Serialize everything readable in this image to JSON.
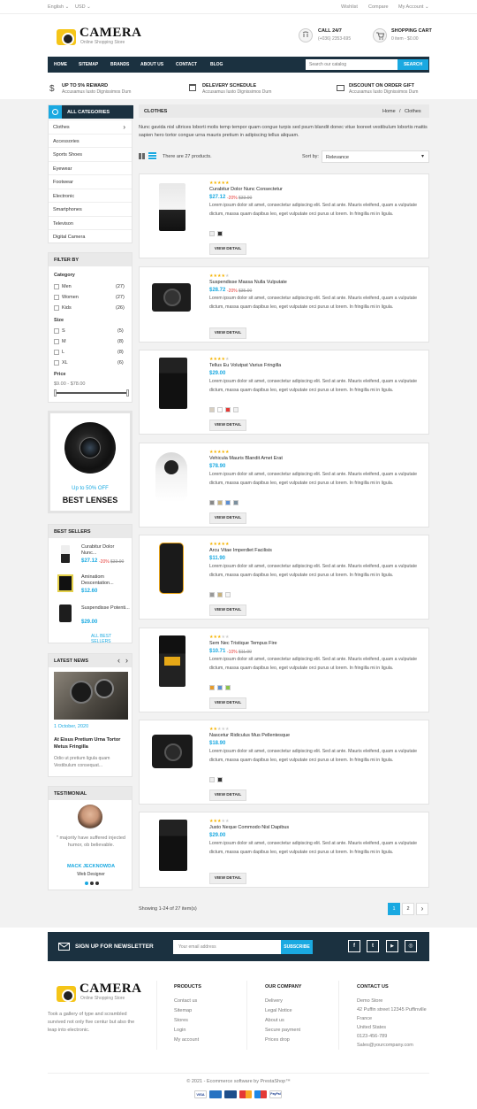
{
  "topbar": {
    "language": "English ⌄",
    "currency": "USD ⌄",
    "wishlist": "Wishlist",
    "compare": "Compare",
    "account": "My Account ⌄"
  },
  "logo": {
    "name": "CAMERA",
    "tagline": "Online Shopping Store"
  },
  "call": {
    "title": "CALL 24/7",
    "phone": "(+036) 2353-695"
  },
  "cart": {
    "title": "SHOPPING CART",
    "summary": "0 item - $0.00"
  },
  "nav": {
    "items": [
      "HOME",
      "SITEMAP",
      "BRANDS",
      "ABOUT US",
      "CONTACT",
      "BLOG"
    ],
    "search_placeholder": "Search our catalog",
    "search_button": "SEARCH"
  },
  "promos": [
    {
      "title": "UP TO 5% REWARD",
      "text": "Accusamus Iusto Dignissimos Dum"
    },
    {
      "title": "DELEVERY SCHEDULE",
      "text": "Accusamus Iusto Dignissimos Dum"
    },
    {
      "title": "DISCOUNT ON ORDER GIFT",
      "text": "Accusamus Iusto Dignissimos Dum"
    }
  ],
  "categories": {
    "title": "ALL CATEGORIES",
    "items": [
      "Clothes",
      "Accessories",
      "Sports Shoes",
      "Eyewear",
      "Footwear",
      "Electronic",
      "Smartphones",
      "Televison",
      "Digital Camera"
    ],
    "arrow": "›"
  },
  "filter": {
    "title": "FILTER BY",
    "category_label": "Category",
    "categories": [
      {
        "name": "Men",
        "count": "(27)"
      },
      {
        "name": "Women",
        "count": "(27)"
      },
      {
        "name": "Kids",
        "count": "(26)"
      }
    ],
    "size_label": "Size",
    "sizes": [
      {
        "name": "S",
        "count": "(5)"
      },
      {
        "name": "M",
        "count": "(8)"
      },
      {
        "name": "L",
        "count": "(8)"
      },
      {
        "name": "XL",
        "count": "(6)"
      }
    ],
    "price_label": "Price",
    "price_range": "$9.00 - $78.00"
  },
  "banner": {
    "offer": "Up to 50% OFF",
    "title": "BEST LENSES"
  },
  "best_sellers": {
    "title": "BEST SELLERS",
    "items": [
      {
        "name": "Curabitur Dolor Nunc...",
        "price": "$27.12",
        "discount": "-20%",
        "old": "$33.90"
      },
      {
        "name": "Aminatiom Descentation...",
        "price": "$12.60",
        "discount": "",
        "old": ""
      },
      {
        "name": "Suspendisse Potenti...",
        "price": "$29.00",
        "discount": "",
        "old": ""
      }
    ],
    "link": "ALL BEST SELLERS"
  },
  "latest_news": {
    "title": "LATEST NEWS",
    "prev": "‹",
    "next": "›",
    "date": "1 October, 2020",
    "headline": "At Eisus Pretium Urna Tortor Metus Fringilla",
    "excerpt": "Odio ut pretium ligula quam Vestibulum consequat..."
  },
  "testimonial": {
    "title": "TESTIMONIAL",
    "quote": "\" majority have suffered injected humor, ob believable.",
    "name": "MACK JECKNOWDA",
    "role": "Web Designer"
  },
  "breadcrumb": {
    "section": "CLOTHES",
    "home": "Home",
    "sep": "/",
    "current": "Clothes"
  },
  "category_desc": "Nunc gavida nisl ultrices loborti molis temp tempor quam congue turpis sed psum blandit donec vitue looreet vestibulum lobortis mattis sapien hero tortor congue urna mauris pretium in adipiscing tellus aliquam.",
  "toolbar": {
    "count": "There are 27 products.",
    "sort_label": "Sort by:",
    "sort_value": "Relevance",
    "sort_arrow": "▾"
  },
  "products": [
    {
      "stars": "★★★★★",
      "name": "Curabitur Dolor Nunc Consectetur",
      "price": "$27.12",
      "discount": "-20%",
      "old": "$33.90",
      "desc": "Lorem ipsum dolor sit amet, consectetur adipiscing elit. Sed at ante. Mauris eleifend, quam a vulputate dictum, massa quam dapibus leo, eget vulputate orci purus ut lorem. In fringilla mi in ligula.",
      "colors": [
        "#eeeeee",
        "#333333"
      ],
      "button": "VIEW DETAIL"
    },
    {
      "stars": "★★★★☆",
      "name": "Suspendisse Massa Nulla Vulputate",
      "price": "$28.72",
      "discount": "-20%",
      "old": "$35.90",
      "desc": "Lorem ipsum dolor sit amet, consectetur adipiscing elit. Sed at ante. Mauris eleifend, quam a vulputate dictum, massa quam dapibus leo, eget vulputate orci purus ut lorem. In fringilla mi in ligula.",
      "colors": [],
      "button": "VIEW DETAIL"
    },
    {
      "stars": "★★★★☆",
      "name": "Tellus Eu Volutpat Varius Fringilla",
      "price": "$29.00",
      "discount": "",
      "old": "",
      "desc": "Lorem ipsum dolor sit amet, consectetur adipiscing elit. Sed at ante. Mauris eleifend, quam a vulputate dictum, massa quam dapibus leo, eget vulputate orci purus ut lorem. In fringilla mi in ligula.",
      "colors": [
        "#d8cfc0",
        "#ffffff",
        "#e53935",
        "#f0f0f0"
      ],
      "button": "VIEW DETAIL"
    },
    {
      "stars": "★★★★★",
      "name": "Vehicula Mauris Blandit Amet Erat",
      "price": "$78.90",
      "discount": "",
      "old": "",
      "desc": "Lorem ipsum dolor sit amet, consectetur adipiscing elit. Sed at ante. Mauris eleifend, quam a vulputate dictum, massa quam dapibus leo, eget vulputate orci purus ut lorem. In fringilla mi in ligula.",
      "colors": [
        "#888888",
        "#c7b07a",
        "#5b8fd4",
        "#7b8f9e"
      ],
      "button": "VIEW DETAIL"
    },
    {
      "stars": "★★★★★",
      "name": "Arcu Vitae Imperdiet Facilisis",
      "price": "$11.90",
      "discount": "",
      "old": "",
      "desc": "Lorem ipsum dolor sit amet, consectetur adipiscing elit. Sed at ante. Mauris eleifend, quam a vulputate dictum, massa quam dapibus leo, eget vulputate orci purus ut lorem. In fringilla mi in ligula.",
      "colors": [
        "#999999",
        "#c7b07a",
        "#f4f4f4"
      ],
      "button": "VIEW DETAIL"
    },
    {
      "stars": "★★★☆☆",
      "name": "Sem Nec Tristique Tempus Fire",
      "price": "$10.71",
      "discount": "-10%",
      "old": "$11.90",
      "desc": "Lorem ipsum dolor sit amet, consectetur adipiscing elit. Sed at ante. Mauris eleifend, quam a vulputate dictum, massa quam dapibus leo, eget vulputate orci purus ut lorem. In fringilla mi in ligula.",
      "colors": [
        "#e69a2a",
        "#5b8fd4",
        "#8bc34a"
      ],
      "button": "VIEW DETAIL"
    },
    {
      "stars": "★★☆☆☆",
      "name": "Nascetur Ridiculus Mus Pellentesque",
      "price": "$18.90",
      "discount": "",
      "old": "",
      "desc": "Lorem ipsum dolor sit amet, consectetur adipiscing elit. Sed at ante. Mauris eleifend, quam a vulputate dictum, massa quam dapibus leo, eget vulputate orci purus ut lorem. In fringilla mi in ligula.",
      "colors": [
        "#eeeeee",
        "#333333"
      ],
      "button": "VIEW DETAIL"
    },
    {
      "stars": "★★★☆☆",
      "name": "Justo Neque Commodo Nisl Dapibus",
      "price": "$29.00",
      "discount": "",
      "old": "",
      "desc": "Lorem ipsum dolor sit amet, consectetur adipiscing elit. Sed at ante. Mauris eleifend, quam a vulputate dictum, massa quam dapibus leo, eget vulputate orci purus ut lorem. In fringilla mi in ligula.",
      "colors": [],
      "button": "VIEW DETAIL"
    }
  ],
  "pagination": {
    "showing": "Showing 1-24 of 27 item(s)",
    "pages": [
      "1",
      "2"
    ],
    "next": "›"
  },
  "newsletter": {
    "title": "SIGN UP FOR NEWSLETTER",
    "placeholder": "Your email address",
    "button": "SUBSCRIBE",
    "socials": [
      "f",
      "t",
      "▶",
      "◎"
    ]
  },
  "footer": {
    "about": "Took a gallery of type and scrambled survived not only five centur but also the leap into electronic.",
    "products": {
      "title": "PRODUCTS",
      "links": [
        "Contact us",
        "Sitemap",
        "Stores",
        "Login",
        "My account"
      ]
    },
    "company": {
      "title": "OUR COMPANY",
      "links": [
        "Delivery",
        "Legal Notice",
        "About us",
        "Secure payment",
        "Prices drop"
      ]
    },
    "contact": {
      "title": "CONTACT US",
      "lines": [
        "Demo Store",
        "42 Puffin street 12345 Puffinville",
        "France",
        "United States",
        "0123-456-789",
        "Sales@yourcompany.com"
      ]
    },
    "copyright": "© 2021 - Ecommerce software by PrestaShop™",
    "payments": [
      "VISA",
      "",
      "",
      "",
      "",
      "PayPal"
    ]
  },
  "colors": {
    "navy": "#1b3140",
    "accent": "#1aa9e1",
    "star": "#f5b301",
    "logo": "#f5c518"
  }
}
